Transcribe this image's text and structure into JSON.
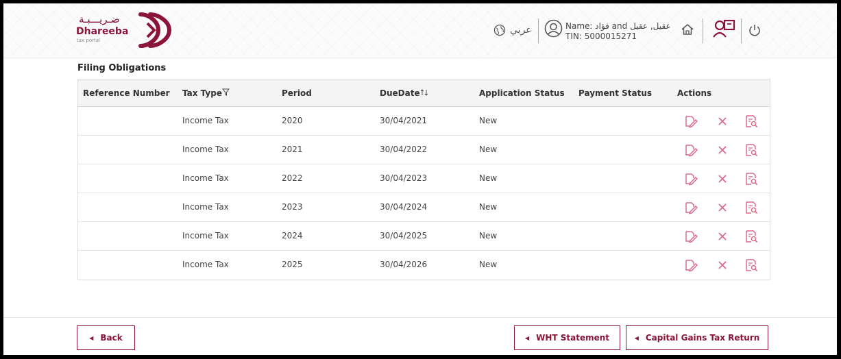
{
  "header": {
    "logo_arabic": "ضـريـــبـة",
    "logo_name": "Dhareeba",
    "logo_sub": "tax portal",
    "language_label": "عربي",
    "user_name": "Name: فؤاد and عقيل, عقيل",
    "user_tin": "TIN: 5000015271"
  },
  "section_title": "Filing Obligations",
  "table": {
    "columns": [
      "Reference Number",
      "Tax Type",
      "Period",
      "DueDate",
      "Application Status",
      "Payment Status",
      "Actions"
    ],
    "rows": [
      {
        "reference": "",
        "tax_type": "Income Tax",
        "period": "2020",
        "due_date": "30/04/2021",
        "app_status": "New",
        "payment_status": ""
      },
      {
        "reference": "",
        "tax_type": "Income Tax",
        "period": "2021",
        "due_date": "30/04/2022",
        "app_status": "New",
        "payment_status": ""
      },
      {
        "reference": "",
        "tax_type": "Income Tax",
        "period": "2022",
        "due_date": "30/04/2023",
        "app_status": "New",
        "payment_status": ""
      },
      {
        "reference": "",
        "tax_type": "Income Tax",
        "period": "2023",
        "due_date": "30/04/2024",
        "app_status": "New",
        "payment_status": ""
      },
      {
        "reference": "",
        "tax_type": "Income Tax",
        "period": "2024",
        "due_date": "30/04/2025",
        "app_status": "New",
        "payment_status": ""
      },
      {
        "reference": "",
        "tax_type": "Income Tax",
        "period": "2025",
        "due_date": "30/04/2026",
        "app_status": "New",
        "payment_status": ""
      }
    ]
  },
  "footer": {
    "back_label": "Back",
    "wht_label": "WHT Statement",
    "cgt_label": "Capital Gains Tax Return"
  },
  "colors": {
    "brand": "#8a1538",
    "action_pink": "#d86a8a"
  }
}
